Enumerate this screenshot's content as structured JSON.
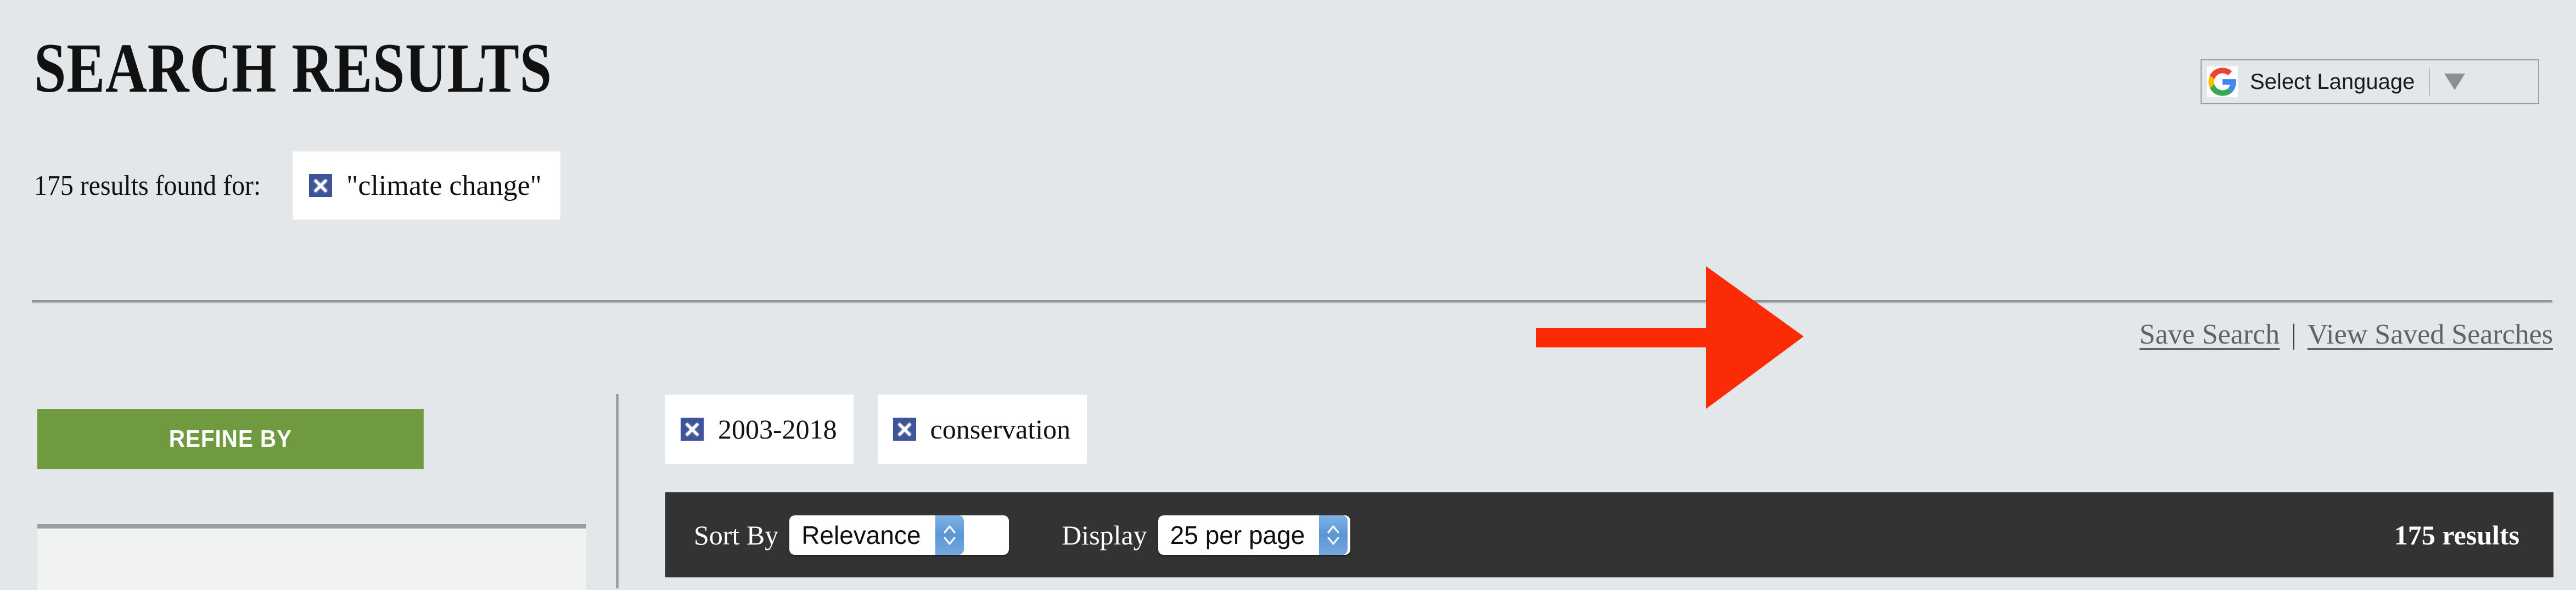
{
  "header": {
    "title": "SEARCH RESULTS",
    "results_found_text": "175 results found for:",
    "query_chip": {
      "label": "\"climate change\"",
      "remove_icon": "close-x-icon"
    }
  },
  "translate": {
    "brand_icon": "google-g-icon",
    "label": "Select Language",
    "caret_icon": "chevron-down-icon"
  },
  "actions": {
    "save_search": "Save Search",
    "separator": "|",
    "view_saved_searches": "View Saved Searches"
  },
  "annotation": {
    "type": "red-arrow",
    "color": "#fa2b05",
    "points_to": "Save Search"
  },
  "sidebar": {
    "refine_by_label": "REFINE BY",
    "accent_color": "#6f9a3f"
  },
  "filters": [
    {
      "label": "2003-2018",
      "remove_icon": "close-x-icon"
    },
    {
      "label": "conservation",
      "remove_icon": "close-x-icon"
    }
  ],
  "toolbar": {
    "sort_by_label": "Sort By",
    "sort_by_value": "Relevance",
    "display_label": "Display",
    "display_value": "25 per page",
    "results_count": "175 results",
    "background_color": "#333333",
    "stepper_icon": "stepper-up-down-icon"
  },
  "colors": {
    "page_background": "#e3e7e9",
    "chip_x_blue": "#3e5499",
    "link_gray": "#5e6366",
    "divider_gray": "#8f9396"
  }
}
